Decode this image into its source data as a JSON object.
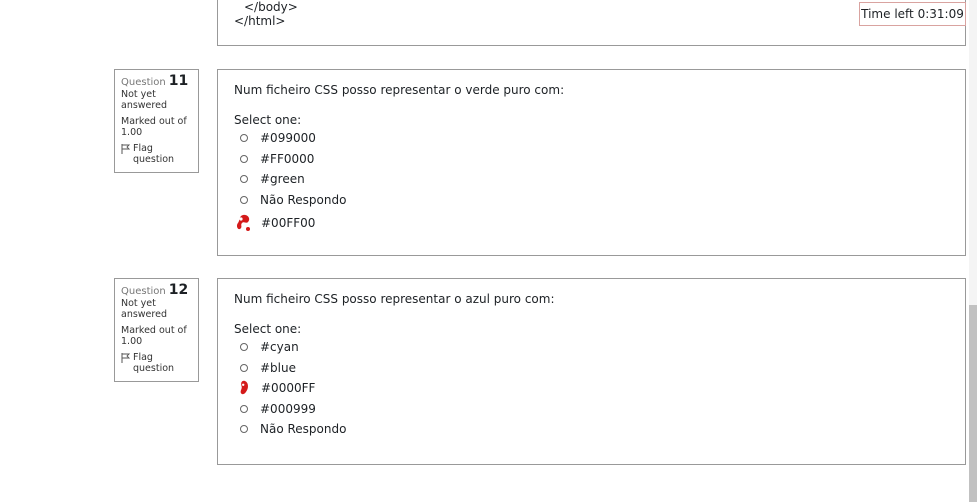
{
  "prev_code": {
    "line1": "</body>",
    "line2": "</html>"
  },
  "timer": "Time left 0:31:09",
  "questions": [
    {
      "label": "Question",
      "number": "11",
      "status": "Not yet answered",
      "marks": "Marked out of 1.00",
      "flag": "Flag question",
      "text": "Num ficheiro CSS posso representar o verde puro com:",
      "select_label": "Select one:",
      "options": [
        "#099000",
        "#FF0000",
        "#green",
        "Não Respondo",
        "#00FF00"
      ],
      "marked_option": 4
    },
    {
      "label": "Question",
      "number": "12",
      "status": "Not yet answered",
      "marks": "Marked out of 1.00",
      "flag": "Flag question",
      "text": "Num ficheiro CSS posso representar o azul puro com:",
      "select_label": "Select one:",
      "options": [
        "#cyan",
        "#blue",
        "#0000FF",
        "#000999",
        "Não Respondo"
      ],
      "marked_option": 2
    }
  ],
  "colors": {
    "mark_red": "#d41a1a",
    "border": "#999999",
    "timer_border": "#d9a3a0"
  }
}
